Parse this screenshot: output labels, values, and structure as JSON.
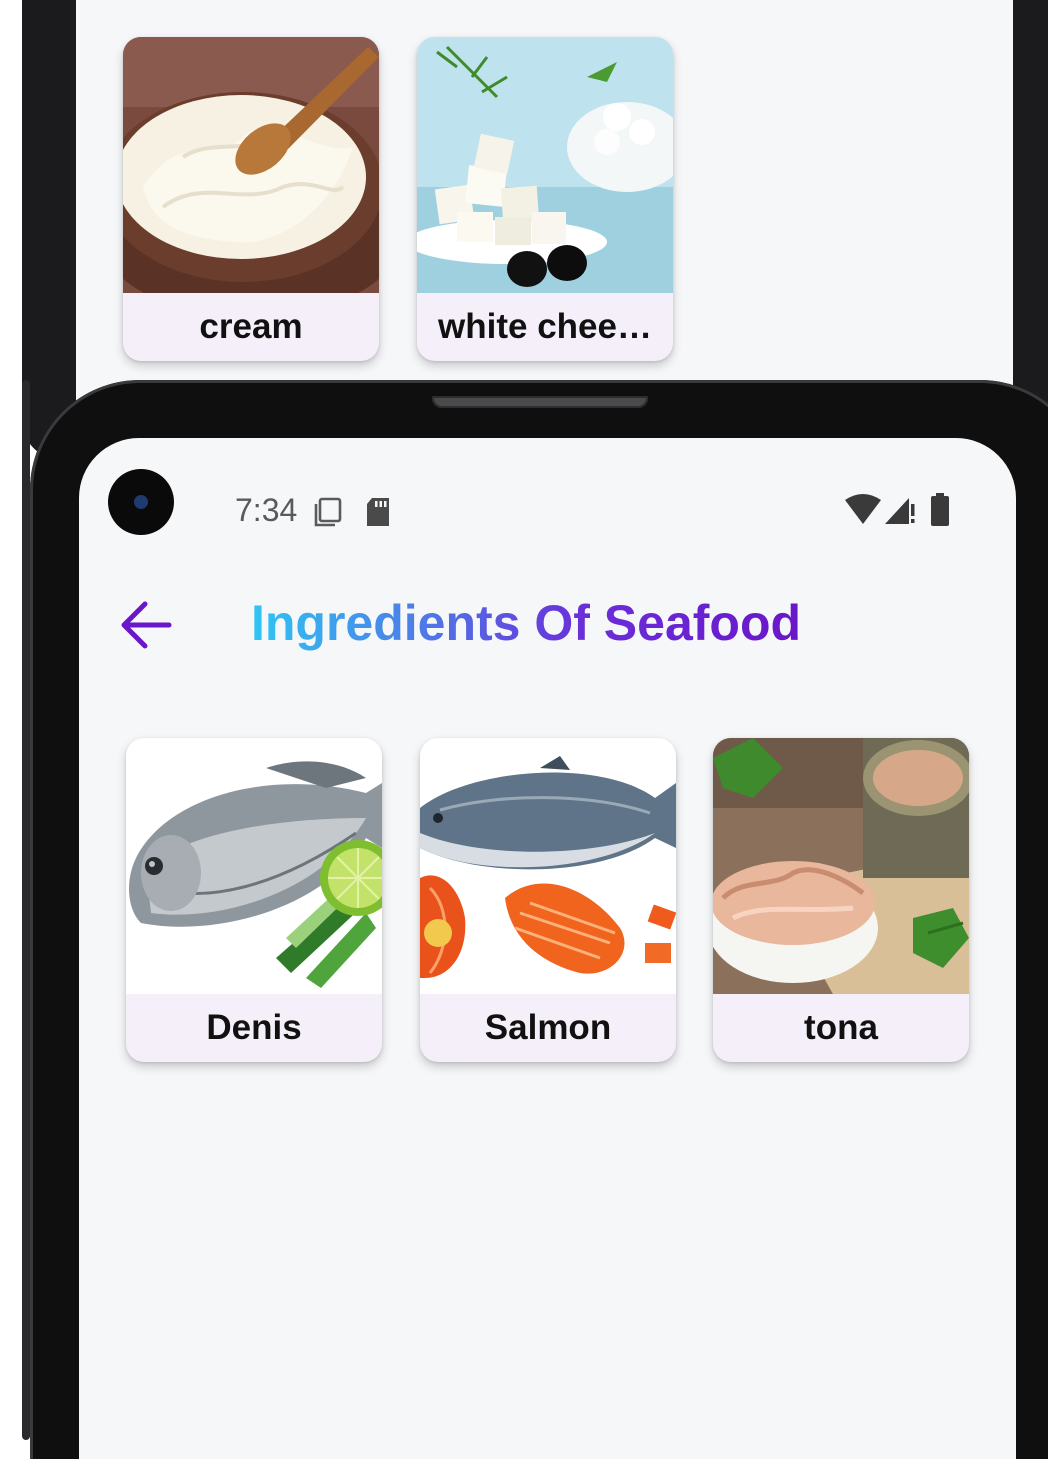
{
  "back_screen": {
    "cards": [
      {
        "label": "cream",
        "image": "cream-bowl-photo"
      },
      {
        "label": "white chee…",
        "image": "white-cheese-photo"
      }
    ]
  },
  "status_bar": {
    "time": "7:34",
    "icons": [
      "screenshot-icon",
      "sd-card-icon",
      "wifi-icon",
      "cell-signal-icon",
      "battery-icon"
    ]
  },
  "header": {
    "back_icon": "arrow-left-icon",
    "title": "Ingredients Of Seafood"
  },
  "ingredients": [
    {
      "label": "Denis",
      "image": "sea-bream-fish-photo"
    },
    {
      "label": "Salmon",
      "image": "salmon-fish-photo"
    },
    {
      "label": "tona",
      "image": "canned-tuna-photo"
    }
  ],
  "colors": {
    "title_gradient_start": "#2ec6f2",
    "title_gradient_end": "#6a16c9",
    "back_arrow": "#6a16c9",
    "card_background": "#f4eff8",
    "screen_background": "#f6f7f9"
  }
}
